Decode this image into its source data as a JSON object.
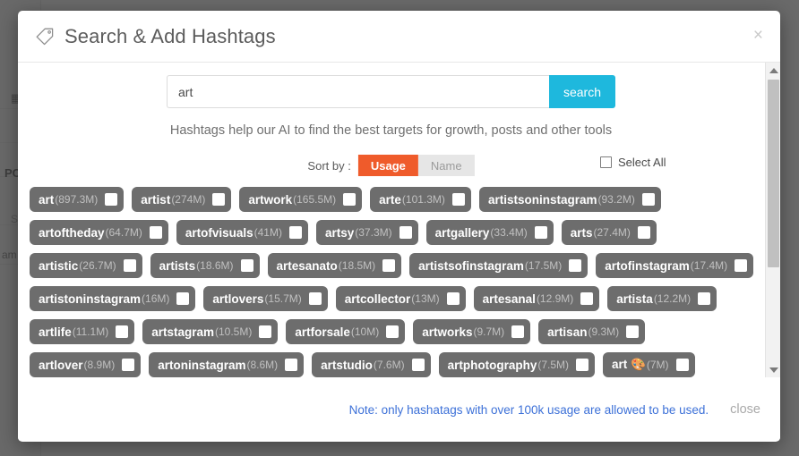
{
  "background": {
    "icon": "grid-icon",
    "label_pc": "PC",
    "label_sa": "Sa",
    "label_am": "am"
  },
  "modal": {
    "title": "Search & Add Hashtags",
    "title_icon": "tag-icon",
    "close_icon": "×",
    "search": {
      "value": "art",
      "placeholder": "",
      "button_label": "search"
    },
    "help_text": "Hashtags help our AI to find the best targets for growth, posts and other tools",
    "sort": {
      "label": "Sort by :",
      "options": [
        "Usage",
        "Name"
      ],
      "active": "Usage"
    },
    "select_all": {
      "label": "Select All",
      "checked": false
    },
    "footer": {
      "note": "Note: only hashatags with over 100k usage are allowed to be used.",
      "close_label": "close"
    },
    "colors": {
      "accent_search": "#1eb8dd",
      "accent_sort_active": "#ef5b2b",
      "tag_background": "#6d6d6d",
      "note_link": "#3d71d8"
    }
  },
  "hashtag_rows": [
    [
      {
        "name": "art",
        "count": "(897.3M)"
      },
      {
        "name": "artist",
        "count": "(274M)"
      },
      {
        "name": "artwork",
        "count": "(165.5M)"
      },
      {
        "name": "arte",
        "count": "(101.3M)"
      },
      {
        "name": "artistsoninstagram",
        "count": "(93.2M)"
      }
    ],
    [
      {
        "name": "artoftheday",
        "count": "(64.7M)"
      },
      {
        "name": "artofvisuals",
        "count": "(41M)"
      },
      {
        "name": "artsy",
        "count": "(37.3M)"
      },
      {
        "name": "artgallery",
        "count": "(33.4M)"
      },
      {
        "name": "arts",
        "count": "(27.4M)"
      }
    ],
    [
      {
        "name": "artistic",
        "count": "(26.7M)"
      },
      {
        "name": "artists",
        "count": "(18.6M)"
      },
      {
        "name": "artesanato",
        "count": "(18.5M)"
      },
      {
        "name": "artistsofinstagram",
        "count": "(17.5M)"
      },
      {
        "name": "artofinstagram",
        "count": "(17.4M)"
      }
    ],
    [
      {
        "name": "artistoninstagram",
        "count": "(16M)"
      },
      {
        "name": "artlovers",
        "count": "(15.7M)"
      },
      {
        "name": "artcollector",
        "count": "(13M)"
      },
      {
        "name": "artesanal",
        "count": "(12.9M)"
      },
      {
        "name": "artista",
        "count": "(12.2M)"
      }
    ],
    [
      {
        "name": "artlife",
        "count": "(11.1M)"
      },
      {
        "name": "artstagram",
        "count": "(10.5M)"
      },
      {
        "name": "artforsale",
        "count": "(10M)"
      },
      {
        "name": "artworks",
        "count": "(9.7M)"
      },
      {
        "name": "artisan",
        "count": "(9.3M)"
      }
    ],
    [
      {
        "name": "artlover",
        "count": "(8.9M)"
      },
      {
        "name": "artoninstagram",
        "count": "(8.6M)"
      },
      {
        "name": "artstudio",
        "count": "(7.6M)"
      },
      {
        "name": "artphotography",
        "count": "(7.5M)"
      },
      {
        "name": "art 🎨",
        "count": "(7M)"
      }
    ]
  ]
}
